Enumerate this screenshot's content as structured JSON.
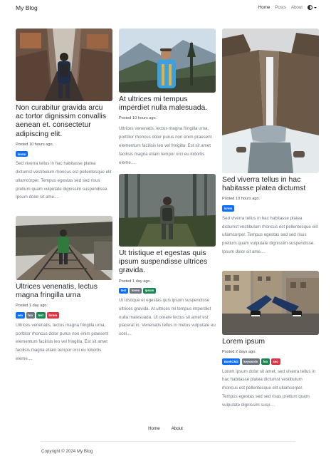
{
  "nav": {
    "brand": "My Blog",
    "links": [
      "Home",
      "Posts",
      "About"
    ],
    "theme_icon": "circle-half-icon"
  },
  "posts": [
    {
      "title": "Non curabitur gravida arcu ac tortor dignissim convallis aenean et. consectetur adipiscing elit.",
      "meta": "Posted 10 hours ago.",
      "tags": [
        "lorem"
      ],
      "excerpt": "Sed viverra tellus in hac habitasse platea dictumst vestibulum rhoncus est pellentesque elit ullamcorper. Tempus egestas sed sed risus pretium quam vulputate dignissim suspendisse. Ipsum dolor sit ame...."
    },
    {
      "title": "At ultrices mi tempus imperdiet nulla malesuada.",
      "meta": "Posted 10 hours ago.",
      "tags": [],
      "excerpt": "Ultrices venenatis, lectus magna fringilla urna, porttitor rhoncus dolor purus non enim praesent elementum facilisis leo vel fringilla. Est sit amet facilisis magna etiam tempor orci eu lobortis eleme...."
    },
    {
      "title": "Sed viverra tellus in hac habitasse platea dictumst",
      "meta": "Posted 10 hours ago.",
      "tags": [
        "lorem"
      ],
      "excerpt": "Sed viverra tellus in hac habitasse platea dictumst vestibulum rhoncus est pellentesque elit ullamcorper. Tempus egestas sed sed risus pretium quam vulputate dignissim suspendisse. Ipsum dolor sit ame...."
    },
    {
      "title": "Ultrices venenatis, lectus magna fringilla urna",
      "meta": "Posted 1 day ago.",
      "tags": [
        "seo",
        "foo",
        "test",
        "lorem"
      ],
      "excerpt": "Ultrices venenatis, lectus magna fringilla urna, porttitor rhoncus dolor purus non enim praesent elementum facilisis leo vel fringilla. Est sit amet facilisis magna etiam tempor orci eu lobortis eleme...."
    },
    {
      "title": "Ut tristique et egestas quis ipsum suspendisse ultrices gravida.",
      "meta": "Posted 1 day ago.",
      "tags": [
        "test",
        "lorem",
        "ipsum"
      ],
      "excerpt": "Ut tristique et egestas quis ipsum suspendisse ultrices gravida. At ultrices mi tempus imperdiet nulla malesuada. Ut ornare lectus sit amet est placerat in. Venenatis tellus in metus vulputate eu scel...."
    },
    {
      "title": "Lorem ipsum",
      "meta": "Posted 2 days ago.",
      "tags": [
        "BookCMS",
        "keywords",
        "foo",
        "seo"
      ],
      "excerpt": "Lorem ipsum dolor sit amet, sed viverra tellus in hac habitasse platea dictumst vestibulum rhoncus est pellentesque elit ullamcorper. Tempus egestas sed sed risus pretium quam vulputate dignissim susp...."
    }
  ],
  "footer": {
    "links": [
      "Home",
      "About"
    ],
    "copyright": "Copyright © 2024 My Blog"
  }
}
